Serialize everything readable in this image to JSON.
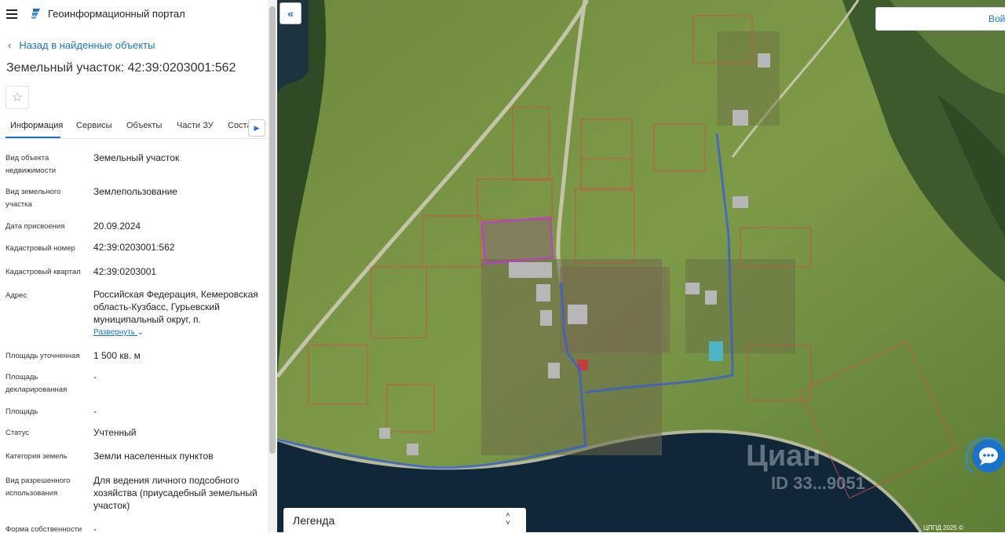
{
  "header": {
    "app_title": "Геоинформационный портал"
  },
  "nav": {
    "back_label": "Назад в найденные объекты"
  },
  "object": {
    "title": "Земельный участок: 42:39:0203001:562"
  },
  "tabs": [
    {
      "label": "Информация",
      "active": true
    },
    {
      "label": "Сервисы"
    },
    {
      "label": "Объекты"
    },
    {
      "label": "Части ЗУ"
    },
    {
      "label": "Соста"
    }
  ],
  "info_rows": [
    {
      "label": "Вид объекта недвижимости",
      "value": "Земельный участок"
    },
    {
      "label": "Вид земельного участка",
      "value": "Землепользование"
    },
    {
      "label": "Дата присвоения",
      "value": "20.09.2024"
    },
    {
      "label": "Кадастровый номер",
      "value": "42:39:0203001:562"
    },
    {
      "label": "Кадастровый квартал",
      "value": "42:39:0203001"
    },
    {
      "label": "Адрес",
      "value": "Российская Федерация, Кемеровская область-Кузбасс, Гурьевский муниципальный округ, п."
    },
    {
      "label": "Площадь уточненная",
      "value": "1 500 кв. м"
    },
    {
      "label": "Площадь декларированная",
      "value": "-"
    },
    {
      "label": "Площадь",
      "value": "-"
    },
    {
      "label": "Статус",
      "value": "Учтенный"
    },
    {
      "label": "Категория земель",
      "value": "Земли населенных пунктов"
    },
    {
      "label": "Вид разрешенного использования",
      "value": "Для ведения личного подсобного хозяйства (приусадебный земельный участок)"
    },
    {
      "label": "Форма собственности",
      "value": "-"
    }
  ],
  "address_expand_label": "Развернуть",
  "map": {
    "login_label": "Вой",
    "legend_label": "Легенда",
    "watermark": "Циан",
    "watermark_id": "ID 33...9051",
    "copyright": "ЦППД 2025 ©"
  },
  "colors": {
    "accent": "#1a73c8",
    "selected_parcel": "#c03ad0",
    "parcel_border": "#d94a4a",
    "boundary": "#3a5fd0"
  }
}
